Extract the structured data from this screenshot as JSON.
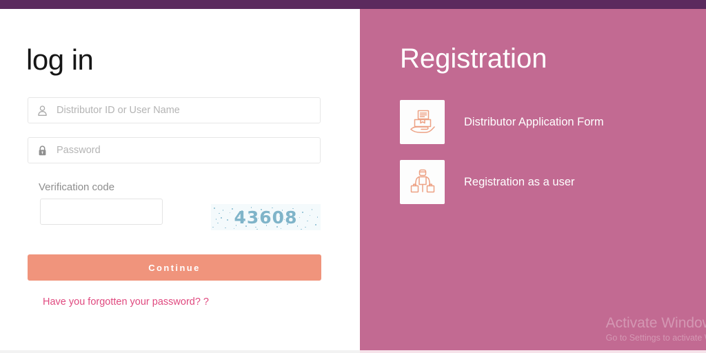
{
  "top_bar": {
    "color": "#5b2a5e"
  },
  "login": {
    "title": "log in",
    "username_field": {
      "icon": "user-icon",
      "placeholder": "Distributor ID or User Name",
      "value": ""
    },
    "password_field": {
      "icon": "lock-icon",
      "placeholder": "Password",
      "value": ""
    },
    "verification": {
      "label": "Verification code",
      "input_value": "",
      "captcha_text": "43608",
      "captcha_color": "#7fb4c9"
    },
    "continue_button": {
      "label": "Continue",
      "color": "#f0947c"
    },
    "forgot_password_link": {
      "label": "Have you forgotten your password? ?",
      "color": "#e0497f"
    }
  },
  "registration": {
    "title": "Registration",
    "background_color": "#c26a92",
    "items": [
      {
        "label": "Distributor Application Form",
        "icon": "package-in-hand-icon"
      },
      {
        "label": "Registration as a user",
        "icon": "person-with-bags-icon"
      }
    ]
  },
  "watermark": {
    "line1": "Activate Windows",
    "line2": "Go to Settings to activate Windows."
  }
}
